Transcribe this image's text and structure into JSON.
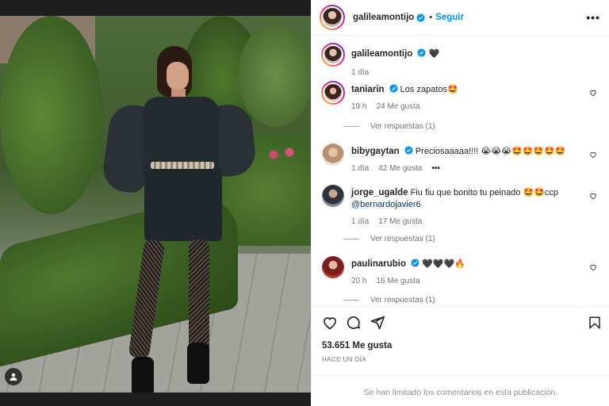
{
  "post": {
    "username": "galileamontijo",
    "follow_label": "Seguir",
    "more_label": "•••",
    "caption_username": "galileamontijo",
    "caption_emoji": "🖤",
    "caption_time": "1 día",
    "likes": "53.651 Me gusta",
    "posted_time": "HACE UN DÍA",
    "comments_limited": "Se han limitado los comentarios en esta publicación."
  },
  "comments": [
    {
      "username": "taniarin",
      "verified": true,
      "text": "Los zapatos🤩",
      "time": "19 h",
      "likes": "24 Me gusta",
      "replies": "Ver respuestas (1)"
    },
    {
      "username": "bibygaytan",
      "verified": true,
      "text": "Preciosaaaaa!!!! 😭😭😭🤩🤩🤩🤩🤩",
      "time": "1 día",
      "likes": "42 Me gusta",
      "options": "•••"
    },
    {
      "username": "jorge_ugalde",
      "verified": false,
      "text": "Fiu fiu que bonito tu peinado 🤩🤩ccp",
      "mention": "@bernardojavier6",
      "time": "1 día",
      "likes": "17 Me gusta",
      "replies": "Ver respuestas (1)"
    },
    {
      "username": "paulinarubio",
      "verified": true,
      "text": "🖤🖤🖤🔥",
      "time": "20 h",
      "likes": "16 Me gusta",
      "replies": "Ver respuestas (1)"
    }
  ],
  "icons": {
    "like": "heart-icon",
    "comment": "comment-icon",
    "share": "share-icon",
    "save": "bookmark-icon",
    "tag": "user-tag-icon"
  },
  "colors": {
    "accent": "#0095f6",
    "verified": "#0095f6",
    "text": "#262626",
    "muted": "#737373",
    "mention": "#00376b"
  }
}
